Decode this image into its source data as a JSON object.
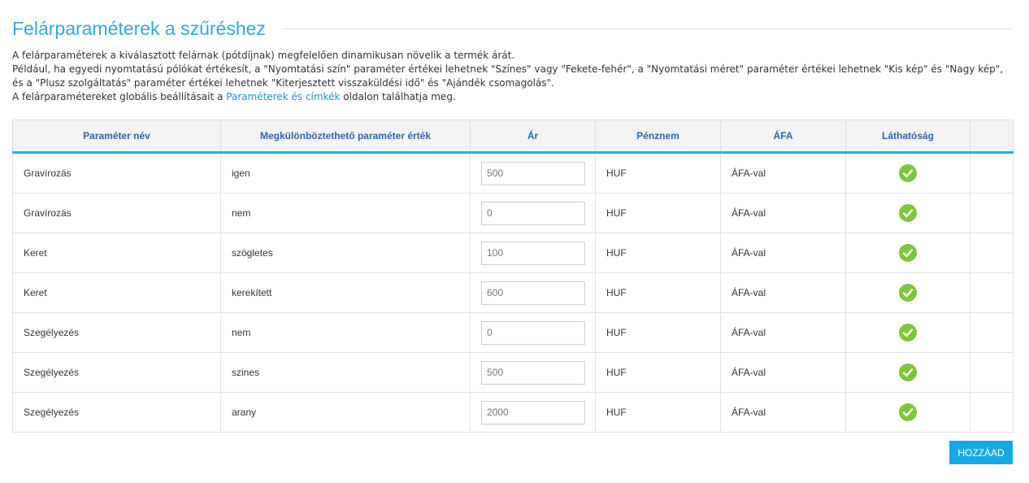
{
  "page": {
    "title": "Felárparaméterek a szűréshez"
  },
  "description": {
    "line1": "A felárparaméterek a kiválasztott felárnak (pótdíjnak) megfelelően dinamikusan növelik a termék árát.",
    "line2": "Például, ha egyedi nyomtatású pólókat értékesít, a \"Nyomtatási szín\" paraméter értékei lehetnek \"Színes\" vagy \"Fekete-fehér\", a \"Nyomtatási méret\" paraméter értékei lehetnek \"Kis kép\" és \"Nagy kép\", és a \"Plusz szolgáltatás\" paraméter értékei lehetnek \"Kiterjesztett visszaküldési idő\" és \"Ajándék csomagolás\".",
    "line3_before": "A felárparamétereket globális beállításait a ",
    "line3_link": "Paraméterek és címkék",
    "line3_after": " oldalon találhatja meg."
  },
  "table": {
    "headers": {
      "name": "Paraméter név",
      "value": "Megkülönböztethető paraméter érték",
      "price": "Ár",
      "currency": "Pénznem",
      "vat": "ÁFA",
      "visibility": "Láthatóság",
      "extra": ""
    },
    "rows": [
      {
        "name": "Gravírozás",
        "value": "igen",
        "price_placeholder": "500",
        "currency": "HUF",
        "vat": "ÁFA-val",
        "visible": true
      },
      {
        "name": "Gravírozás",
        "value": "nem",
        "price_placeholder": "0",
        "currency": "HUF",
        "vat": "ÁFA-val",
        "visible": true
      },
      {
        "name": "Keret",
        "value": "szögletes",
        "price_placeholder": "100",
        "currency": "HUF",
        "vat": "ÁFA-val",
        "visible": true
      },
      {
        "name": "Keret",
        "value": "kerekített",
        "price_placeholder": "600",
        "currency": "HUF",
        "vat": "ÁFA-val",
        "visible": true
      },
      {
        "name": "Szegélyezés",
        "value": "nem",
        "price_placeholder": "0",
        "currency": "HUF",
        "vat": "ÁFA-val",
        "visible": true
      },
      {
        "name": "Szegélyezés",
        "value": "szines",
        "price_placeholder": "500",
        "currency": "HUF",
        "vat": "ÁFA-val",
        "visible": true
      },
      {
        "name": "Szegélyezés",
        "value": "arany",
        "price_placeholder": "2000",
        "currency": "HUF",
        "vat": "ÁFA-val",
        "visible": true
      }
    ],
    "visible_icon": "check-circle-icon"
  },
  "actions": {
    "add_label": "HOZZÁAD"
  },
  "colors": {
    "title": "#33a9dd",
    "header_text": "#2a66b3",
    "header_border": "#33a9dd",
    "check": "#7fc53e",
    "button_bg": "#19a9e2"
  }
}
